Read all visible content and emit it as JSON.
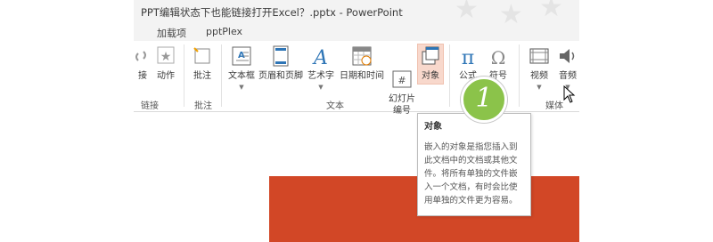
{
  "window": {
    "title": "PPT编辑状态下也能链接打开Excel？.pptx - PowerPoint"
  },
  "tabs": [
    {
      "label": "加载项"
    },
    {
      "label": "pptPlex"
    }
  ],
  "ribbon": {
    "groups": [
      {
        "label": "链接",
        "buttons": [
          {
            "label": "接"
          },
          {
            "label": "动作"
          }
        ]
      },
      {
        "label": "批注",
        "buttons": [
          {
            "label": "批注"
          }
        ]
      },
      {
        "label": "文本",
        "buttons": [
          {
            "label": "文本框",
            "has_dropdown": true
          },
          {
            "label": "页眉和页脚"
          },
          {
            "label": "艺术字",
            "has_dropdown": true
          },
          {
            "label": "日期和时间"
          },
          {
            "label": "幻灯片\n编号"
          },
          {
            "label": "对象"
          }
        ]
      },
      {
        "label": "",
        "buttons": [
          {
            "label": "公式"
          },
          {
            "label": "符号"
          }
        ]
      },
      {
        "label": "媒体",
        "buttons": [
          {
            "label": "视频"
          },
          {
            "label": "音频"
          }
        ]
      }
    ]
  },
  "badge": {
    "number": "1"
  },
  "tooltip": {
    "title": "对象",
    "body": "嵌入的对象是指您插入到此文档中的文档或其他文件。将所有单独的文件嵌入一个文档，有时会比使用单独的文件更为容易。"
  },
  "colors": {
    "slide": "#d24726",
    "badge": "#8bc34a",
    "highlight": "#f8d8cc",
    "titlebar": "#f3f3f3"
  }
}
